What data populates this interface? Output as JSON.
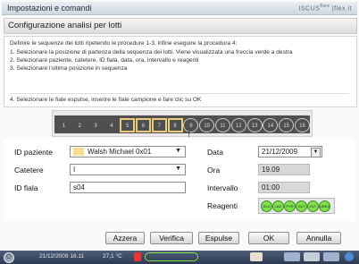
{
  "titlebar": {
    "title": "Impostazioni e comandi",
    "logo": "ISCUS",
    "logo_sup": "flex",
    "logo_suffix": "|flex.it"
  },
  "header": {
    "title": "Configurazione analisi per lotti"
  },
  "instructions": {
    "lines": [
      "Definire le sequenze dei lotti ripetendo le procedure 1-3, infine eseguire la procedura 4:",
      "1. Selezionare la posizione di partenza della sequenza dei lotti. Viene visualizzata una freccia verde a destra",
      "2. Selezionare paziente, catetere, ID fiala, data, ora, intervallo e reagenti",
      "3. Selezionare l'ultima posizione in sequenza",
      "4. Selezionare le fiale espulse, inserire le fiale campione e fare clic su OK"
    ]
  },
  "sequence": {
    "numbers": [
      "1",
      "2",
      "3",
      "4",
      "5",
      "6",
      "7",
      "8",
      "9",
      "10",
      "11",
      "12",
      "13",
      "14",
      "15",
      "16"
    ]
  },
  "form": {
    "patient_label": "ID paziente",
    "patient_value": "Walsh Michael 0x01",
    "catheter_label": "Catetere",
    "catheter_value": "I",
    "vial_label": "ID fiala",
    "vial_value": "s04",
    "date_label": "Data",
    "date_value": "21/12/2009",
    "time_label": "Ora",
    "time_value": "19.09",
    "interval_label": "Intervallo",
    "interval_value": "01:00",
    "reagents_label": "Reagenti",
    "reagents": [
      "GLU",
      "LAC",
      "PYR",
      "GLY",
      "GLT",
      "UREA"
    ]
  },
  "buttons": {
    "reset": "Azzera",
    "verify": "Verifica",
    "eject": "Espulse",
    "ok": "OK",
    "cancel": "Annulla"
  },
  "status": {
    "datetime": "21/12/2009 16.11",
    "temp": "27,1 °C"
  },
  "colors": {
    "slot_selected": "#e6cc7b",
    "reagent": "#7fe04a",
    "status_bg": "#2d3a51"
  }
}
